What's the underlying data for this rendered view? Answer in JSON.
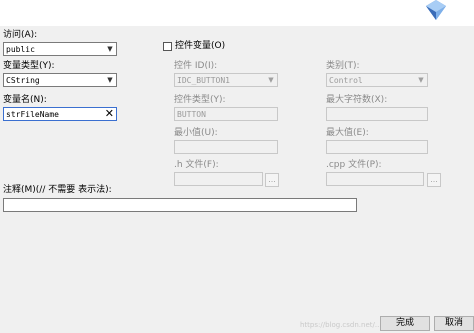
{
  "left": {
    "access_label": "访问(A):",
    "access_value": "public",
    "var_type_label": "变量类型(Y):",
    "var_type_value": "CString",
    "var_name_label": "变量名(N):",
    "var_name_value": "strFileName",
    "comment_label": "注释(M)(// 不需要 表示法):",
    "comment_value": ""
  },
  "control_var": {
    "checkbox_label": "控件变量(O)",
    "checked": false,
    "control_id_label": "控件 ID(I):",
    "control_id_value": "IDC_BUTTON1",
    "category_label": "类别(T):",
    "category_value": "Control",
    "control_type_label": "控件类型(Y):",
    "control_type_value": "BUTTON",
    "max_chars_label": "最大字符数(X):",
    "min_value_label": "最小值(U):",
    "max_value_label": "最大值(E):",
    "h_file_label": ".h 文件(F):",
    "cpp_file_label": ".cpp 文件(P):",
    "browse_label": "..."
  },
  "buttons": {
    "finish": "完成",
    "cancel": "取消"
  },
  "watermark": "https://blog.csdn.net/...",
  "icons": {
    "chevron": "▼",
    "clear": "✕"
  }
}
